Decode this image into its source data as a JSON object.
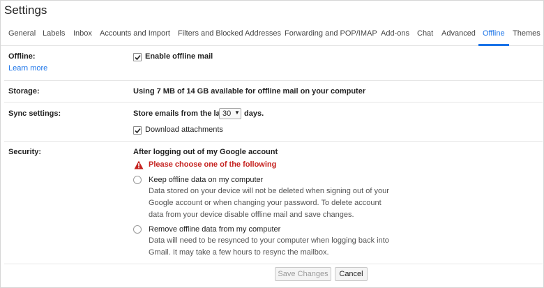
{
  "header": {
    "title": "Settings"
  },
  "tabs": [
    {
      "label": "General"
    },
    {
      "label": "Labels"
    },
    {
      "label": "Inbox"
    },
    {
      "label": "Accounts and Import"
    },
    {
      "label": "Filters and Blocked Addresses"
    },
    {
      "label": "Forwarding and POP/IMAP"
    },
    {
      "label": "Add-ons"
    },
    {
      "label": "Chat"
    },
    {
      "label": "Advanced"
    },
    {
      "label": "Offline"
    },
    {
      "label": "Themes"
    }
  ],
  "offline": {
    "label": "Offline:",
    "learn_more": "Learn more",
    "enable_label": "Enable offline mail",
    "enabled": true
  },
  "storage": {
    "label": "Storage:",
    "text": "Using 7 MB of 14 GB available for offline mail on your computer"
  },
  "sync": {
    "label": "Sync settings:",
    "prefix": "Store emails from the last",
    "days_value": "30",
    "suffix": "days.",
    "download_label": "Download attachments",
    "download_checked": true
  },
  "security": {
    "label": "Security:",
    "heading": "After logging out of my Google account",
    "warning": "Please choose one of the following",
    "keep_label": "Keep offline data on my computer",
    "keep_desc": "Data stored on your device will not be deleted when signing out of your Google account or when changing your password. To delete account data from your device disable offline mail and save changes.",
    "remove_label": "Remove offline data from my computer",
    "remove_desc": "Data will need to be resynced to your computer when logging back into Gmail. It may take a few hours to resync the mailbox."
  },
  "footer": {
    "save_label": "Save Changes",
    "cancel_label": "Cancel"
  },
  "colors": {
    "accent": "#1a73e8",
    "warning": "#c5221f"
  }
}
